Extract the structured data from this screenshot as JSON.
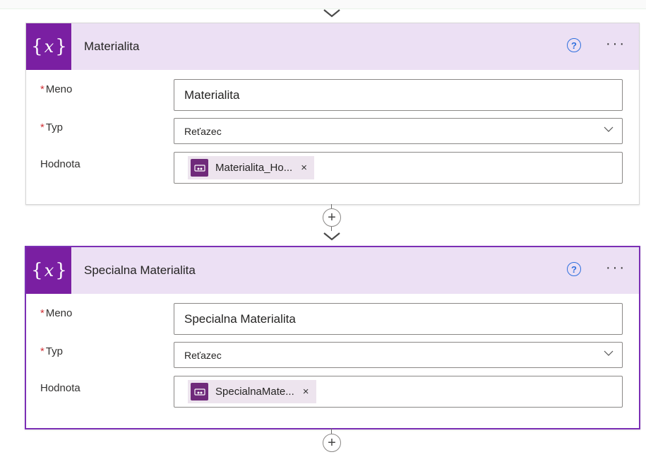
{
  "cards": [
    {
      "title": "Materialita",
      "fields": {
        "name_label": "Meno",
        "name_value": "Materialita",
        "type_label": "Typ",
        "type_value": "Reťazec",
        "value_label": "Hodnota",
        "value_token": "Materialita_Ho..."
      }
    },
    {
      "title": "Specialna Materialita",
      "fields": {
        "name_label": "Meno",
        "name_value": "Specialna Materialita",
        "type_label": "Typ",
        "type_value": "Reťazec",
        "value_label": "Hodnota",
        "value_token": "SpecialnaMate..."
      }
    }
  ],
  "required_mark": "*",
  "icons": {
    "variable": "variable-icon",
    "help": "help-icon",
    "more": "more-options-icon",
    "token": "power-apps-token-icon",
    "remove": "remove-token-icon",
    "add_step": "add-step-icon"
  },
  "colors": {
    "accent": "#7a1fa2",
    "header_bg": "#ece0f4",
    "selected_border": "#7b2fb5",
    "help_blue": "#2f6fde",
    "required_red": "#d13438"
  }
}
